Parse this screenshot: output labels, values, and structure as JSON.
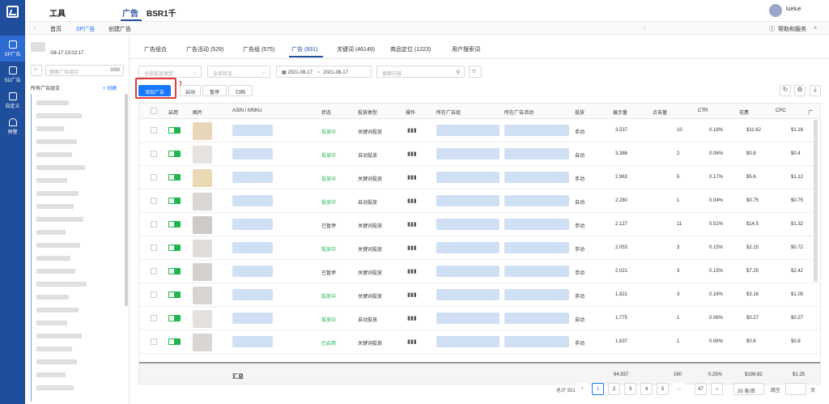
{
  "rail": {
    "items": [
      {
        "label": "SP广告",
        "icon": "sp-icon"
      },
      {
        "label": "SD广告",
        "icon": "sd-icon"
      },
      {
        "label": "自定义",
        "icon": "custom-icon"
      },
      {
        "label": "预警",
        "icon": "alarm-icon"
      }
    ]
  },
  "topnav": {
    "tabs": [
      "工具",
      "广告",
      "BSR1千"
    ],
    "active": "广告",
    "user": "luelue"
  },
  "breadcrumb": {
    "items": [
      "首页",
      "SP广告",
      "创建广告"
    ],
    "help": "帮助和服务"
  },
  "sidebar": {
    "date": "-08-17 23:02:17",
    "search_placeholder": "搜索广告组合",
    "count": "0/50",
    "all": "所有广告组合",
    "create": "+ 创建"
  },
  "main": {
    "tabs": [
      "广告组合",
      "广告活动 (529)",
      "广告组 (575)",
      "广告 (931)",
      "关键词 (46149)",
      "商品定位 (1223)",
      "用户搜索词"
    ],
    "filters": {
      "type": "全部投放类型",
      "status": "全部状态",
      "date_from": "2021-08-17",
      "date_sep": "~",
      "date_to": "2021-08-17",
      "search": "搜索内容"
    },
    "buttons": {
      "add": "添加广告",
      "enable": "启动",
      "pause": "暂停",
      "archive": "归档"
    },
    "annotation": "1",
    "columns": [
      "启用",
      "图片",
      "ASIN / MSKU",
      "状态",
      "投放类型",
      "操作",
      "所在广告组",
      "所在广告活动",
      "投放",
      "展示量",
      "点击量",
      "CTR",
      "花费",
      "CPC",
      "广"
    ],
    "rows": [
      {
        "status": "投放中",
        "type": "关键词投放",
        "mode": "手动",
        "impr": "3,537",
        "clicks": "10",
        "ctr": "0.18%",
        "cost": "$11.62",
        "cpc": "$1.16"
      },
      {
        "status": "投放中",
        "type": "自动投放",
        "mode": "自动",
        "impr": "3,386",
        "clicks": "2",
        "ctr": "0.06%",
        "cost": "$0.8",
        "cpc": "$0.4"
      },
      {
        "status": "投放中",
        "type": "关键词投放",
        "mode": "手动",
        "impr": "2,963",
        "clicks": "5",
        "ctr": "0.17%",
        "cost": "$5.6",
        "cpc": "$1.12"
      },
      {
        "status": "投放中",
        "type": "自动投放",
        "mode": "自动",
        "impr": "2,280",
        "clicks": "1",
        "ctr": "0.04%",
        "cost": "$0.75",
        "cpc": "$0.75"
      },
      {
        "status": "已暂停",
        "type": "关键词投放",
        "mode": "手动",
        "impr": "2,127",
        "clicks": "11",
        "ctr": "0.51%",
        "cost": "$14.5",
        "cpc": "$1.32"
      },
      {
        "status": "投放中",
        "type": "关键词投放",
        "mode": "手动",
        "impr": "2,053",
        "clicks": "3",
        "ctr": "0.15%",
        "cost": "$2.15",
        "cpc": "$0.72"
      },
      {
        "status": "已暂停",
        "type": "关键词投放",
        "mode": "手动",
        "impr": "2,021",
        "clicks": "3",
        "ctr": "0.15%",
        "cost": "$7.25",
        "cpc": "$2.42"
      },
      {
        "status": "投放中",
        "type": "关键词投放",
        "mode": "手动",
        "impr": "1,921",
        "clicks": "3",
        "ctr": "0.16%",
        "cost": "$3.16",
        "cpc": "$1.05"
      },
      {
        "status": "投放中",
        "type": "自动投放",
        "mode": "自动",
        "impr": "1,775",
        "clicks": "1",
        "ctr": "0.06%",
        "cost": "$0.27",
        "cpc": "$0.27"
      },
      {
        "status": "已启用",
        "type": "关键词投放",
        "mode": "手动",
        "impr": "1,637",
        "clicks": "1",
        "ctr": "0.06%",
        "cost": "$0.8",
        "cpc": "$0.8"
      }
    ],
    "summary": {
      "label": "汇总",
      "impr": "64,937",
      "clicks": "160",
      "ctr": "0.25%",
      "cost": "$199.82",
      "cpc": "$1.25"
    },
    "pagination": {
      "total": "总计 931 条",
      "pages": [
        "1",
        "2",
        "3",
        "4",
        "5",
        "...",
        "47"
      ],
      "active": "1",
      "per_page": "20 条/页",
      "goto": "跳至",
      "page": "页"
    }
  }
}
